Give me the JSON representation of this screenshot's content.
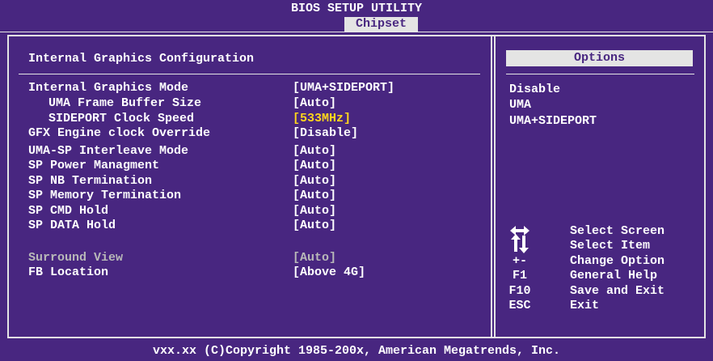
{
  "header": {
    "title": "BIOS SETUP UTILITY",
    "active_tab": "Chipset"
  },
  "main": {
    "section_title": "Internal Graphics Configuration",
    "settings": [
      {
        "label": "Internal Graphics Mode",
        "value": "[UMA+SIDEPORT]"
      },
      {
        "label": "UMA Frame Buffer Size",
        "value": "[Auto]"
      },
      {
        "label": "SIDEPORT Clock Speed",
        "value": "[533MHz]"
      },
      {
        "label": "GFX Engine clock Override",
        "value": "[Disable]"
      },
      {
        "label": "UMA-SP Interleave Mode",
        "value": "[Auto]"
      },
      {
        "label": "SP Power Managment",
        "value": "[Auto]"
      },
      {
        "label": "SP NB Termination",
        "value": "[Auto]"
      },
      {
        "label": "SP Memory Termination",
        "value": "[Auto]"
      },
      {
        "label": "SP CMD Hold",
        "value": "[Auto]"
      },
      {
        "label": "SP DATA Hold",
        "value": "[Auto]"
      },
      {
        "label": "Surround View",
        "value": "[Auto]"
      },
      {
        "label": "FB Location",
        "value": "[Above 4G]"
      }
    ]
  },
  "options": {
    "title": "Options",
    "items": [
      "Disable",
      "UMA",
      "UMA+SIDEPORT"
    ]
  },
  "help": [
    {
      "key": "",
      "icon": "left-right-arrows-icon",
      "text": "Select Screen"
    },
    {
      "key": "",
      "icon": "up-down-arrows-icon",
      "text": "Select Item"
    },
    {
      "key": "+-",
      "text": "Change Option"
    },
    {
      "key": "F1",
      "text": "General Help"
    },
    {
      "key": "F10",
      "text": "Save and Exit"
    },
    {
      "key": "ESC",
      "text": "Exit"
    }
  ],
  "footer": {
    "copyright": "vxx.xx (C)Copyright 1985-200x, American Megatrends, Inc."
  },
  "colors": {
    "background": "#482680",
    "foreground": "#ffffff",
    "highlight": "#ffd61c",
    "disabled": "#b8b8b8",
    "tab_background": "#e4e4e4"
  }
}
